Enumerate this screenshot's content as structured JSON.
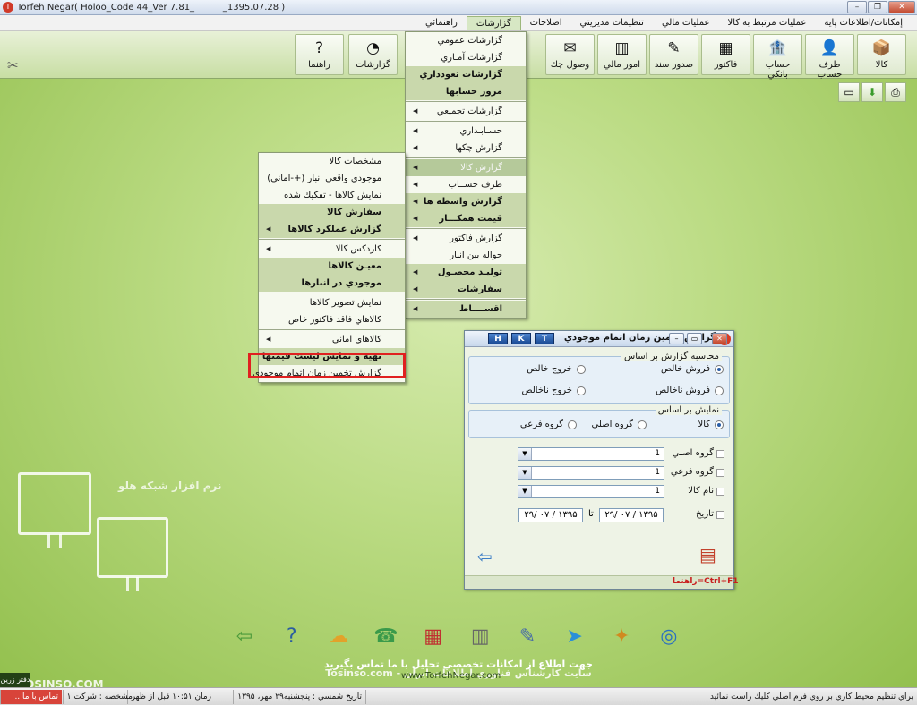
{
  "window": {
    "title": "Torfeh Negar( Holoo_Code 44_Ver 7.81_          _1395.07.28 )",
    "app_icon_glyph": "T"
  },
  "menubar": [
    "إمكانات/اطلاعات پايه",
    "عمليات مرتبط به كالا",
    "عمليات مالي",
    "تنظيمات مديريتي",
    "اصلاحات",
    "گزارشات",
    "راهنمائي"
  ],
  "toolbar": [
    {
      "label": "كالا",
      "icon": "box-icon"
    },
    {
      "label": "طرف حساب",
      "icon": "user-icon"
    },
    {
      "label": "حساب بانكي",
      "icon": "bank-icon"
    },
    {
      "label": "فاكتور",
      "icon": "invoice-icon"
    },
    {
      "label": "صدور سند",
      "icon": "document-icon"
    },
    {
      "label": "امور مالي",
      "icon": "calculator-icon"
    },
    {
      "label": "وصول چك",
      "icon": "cheque-icon"
    },
    {
      "label": "گزارشات",
      "icon": "report-icon"
    },
    {
      "label": "راهنما",
      "icon": "help-icon"
    }
  ],
  "reports_menu": [
    {
      "label": "گزارشات عمومي",
      "style": "normal",
      "arrow": false
    },
    {
      "label": "گزارشات آمـاري",
      "style": "normal",
      "arrow": false
    },
    {
      "label": "گزارشات تعودداري",
      "style": "bold",
      "arrow": false
    },
    {
      "label": "مرور حسابها",
      "style": "bold",
      "arrow": false
    },
    {
      "sep": true
    },
    {
      "label": "گزارشات تجميعي",
      "style": "normal",
      "arrow": true
    },
    {
      "sep": true
    },
    {
      "label": "حسـابـداري",
      "style": "normal",
      "arrow": true
    },
    {
      "label": "گزارش چكها",
      "style": "normal",
      "arrow": true
    },
    {
      "sep": true
    },
    {
      "label": "گزارش كالا",
      "style": "hl",
      "arrow": true
    },
    {
      "label": "طرف حســاب",
      "style": "normal",
      "arrow": true
    },
    {
      "label": "گزارش واسطه ها",
      "style": "bold",
      "arrow": true
    },
    {
      "label": "قيمت همكـــار",
      "style": "bold",
      "arrow": true
    },
    {
      "sep": true
    },
    {
      "label": "گزارش فاكتور",
      "style": "normal",
      "arrow": true
    },
    {
      "label": "حواله بين انبار",
      "style": "normal",
      "arrow": false
    },
    {
      "label": "توليـد محصـول",
      "style": "bold",
      "arrow": true
    },
    {
      "label": "سفارشات",
      "style": "bold",
      "arrow": true
    },
    {
      "sep": true
    },
    {
      "label": "اقســــاط",
      "style": "bold",
      "arrow": true
    }
  ],
  "goods_menu": [
    {
      "label": "مشخصات كالا",
      "style": "normal",
      "arrow": false
    },
    {
      "label": "موجودي واقعي انبار (+-اماني)",
      "style": "normal",
      "arrow": false
    },
    {
      "label": "نمايش كالاها - تفكيك شده",
      "style": "normal",
      "arrow": false
    },
    {
      "label": "سفارش كالا",
      "style": "bold",
      "arrow": false
    },
    {
      "label": "گزارش عملكرد كالاها",
      "style": "bold",
      "arrow": true
    },
    {
      "sep": true
    },
    {
      "label": "كاردكس كالا",
      "style": "normal",
      "arrow": true
    },
    {
      "label": "معيـن كالاها",
      "style": "bold",
      "arrow": false
    },
    {
      "label": "موجودي در انبارها",
      "style": "bold",
      "arrow": false
    },
    {
      "sep": true
    },
    {
      "label": "نمايش تصوير كالاها",
      "style": "normal",
      "arrow": false
    },
    {
      "label": "كالاهاي فاقد فاكتور خاص",
      "style": "normal",
      "arrow": false
    },
    {
      "sep": true
    },
    {
      "label": "كالاهاي اماني",
      "style": "normal",
      "arrow": true
    },
    {
      "label": "تهيه و نمايش ليست قيمتها",
      "style": "bold",
      "arrow": false
    },
    {
      "label": "گزارش تخمين زمان اتمام موجودي",
      "style": "normal",
      "arrow": false
    }
  ],
  "dialog": {
    "title": "گزارش تخمين زمان اتمام موجودي",
    "hkt": [
      "H",
      "K",
      "T"
    ],
    "calc_group": {
      "legend": "محاسبه گزارش بر اساس",
      "options": [
        "فروش خالص",
        "خروج خالص",
        "فروش ناخالص",
        "خروج ناخالص"
      ],
      "selected": 0
    },
    "display_group": {
      "legend": "نمايش بر اساس",
      "options": [
        "كالا",
        "گروه اصلي",
        "گروه فرعي"
      ],
      "selected": 0
    },
    "fields": [
      {
        "label": "گروه اصلي",
        "value": "1"
      },
      {
        "label": "گروه فرعي",
        "value": "1"
      },
      {
        "label": "نام كالا",
        "value": "1"
      }
    ],
    "date": {
      "label": "تاريخ",
      "from": "۱۳۹۵ / ۰۷ /۲۹",
      "to_label": "تا",
      "to": "۱۳۹۵ / ۰۷ /۲۹"
    },
    "help_hint": "راهنما=Ctrl+F1"
  },
  "desktop": {
    "brand_text": "نرم افزار شبكه هلو",
    "banner_line1": "جهت اطلاع از امكانات تخصصي تحليل با ما تماس بگيريد",
    "banner_line2": "سايت كارشناس فناوري اطلاعات ايران - Tosinso.com",
    "banner_url": "www.TorfehNegar.com",
    "watermark": "TOSINSO.COM",
    "dock_icons": [
      "exit-icon",
      "help-icon",
      "weather-icon",
      "phone-icon",
      "calendar-icon",
      "calculator-icon",
      "notepad-icon",
      "telegram-icon",
      "logo-icon",
      "website-icon"
    ]
  },
  "status": {
    "hint": "براي تنظيم محيط كاري بر روي فرم اصلي كليك راست نمائيد",
    "date": "تاريخ شمسي : پنجشنبه۲۹ مهر، ۱۳۹۵",
    "time": "زمان ۱۰:۵۱ قبل از ظهر",
    "company": "مشخصه : شركت ۱",
    "contact": "تماس با ما...",
    "side_tag": "دفتر زرين"
  }
}
